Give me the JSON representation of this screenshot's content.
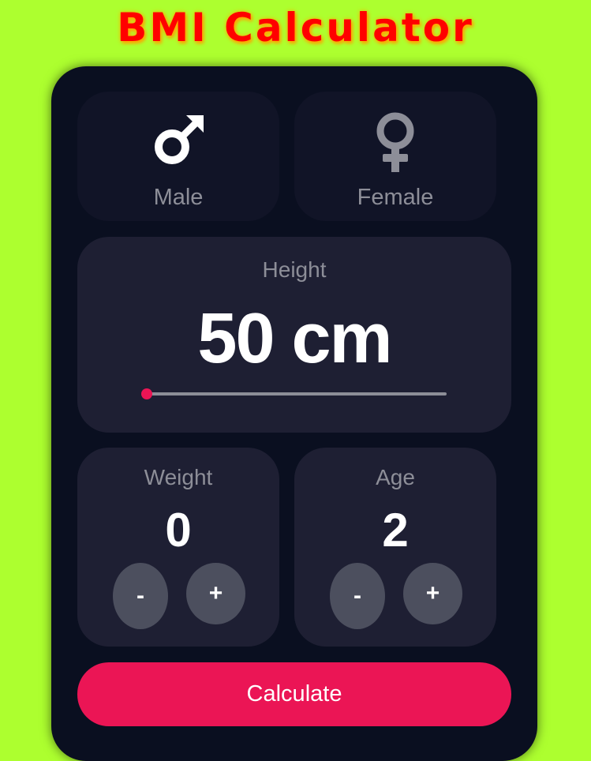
{
  "app": {
    "title": "BMI Calculator"
  },
  "gender": {
    "male": {
      "label": "Male",
      "icon": "male-icon"
    },
    "female": {
      "label": "Female",
      "icon": "female-icon"
    }
  },
  "height": {
    "label": "Height",
    "display": "50 cm",
    "value": 50,
    "unit": "cm",
    "slider_fraction": 0
  },
  "weight": {
    "label": "Weight",
    "value": "0",
    "minus_label": "-",
    "plus_label": "+"
  },
  "age": {
    "label": "Age",
    "value": "2",
    "minus_label": "-",
    "plus_label": "+"
  },
  "calculate": {
    "label": "Calculate"
  },
  "colors": {
    "background": "#adff2f",
    "title": "#ff0000",
    "card": "#0a0f20",
    "tile": "#1e1f33",
    "accent": "#eb1555",
    "muted_text": "#8d8e98",
    "button": "#4c4f5e"
  }
}
